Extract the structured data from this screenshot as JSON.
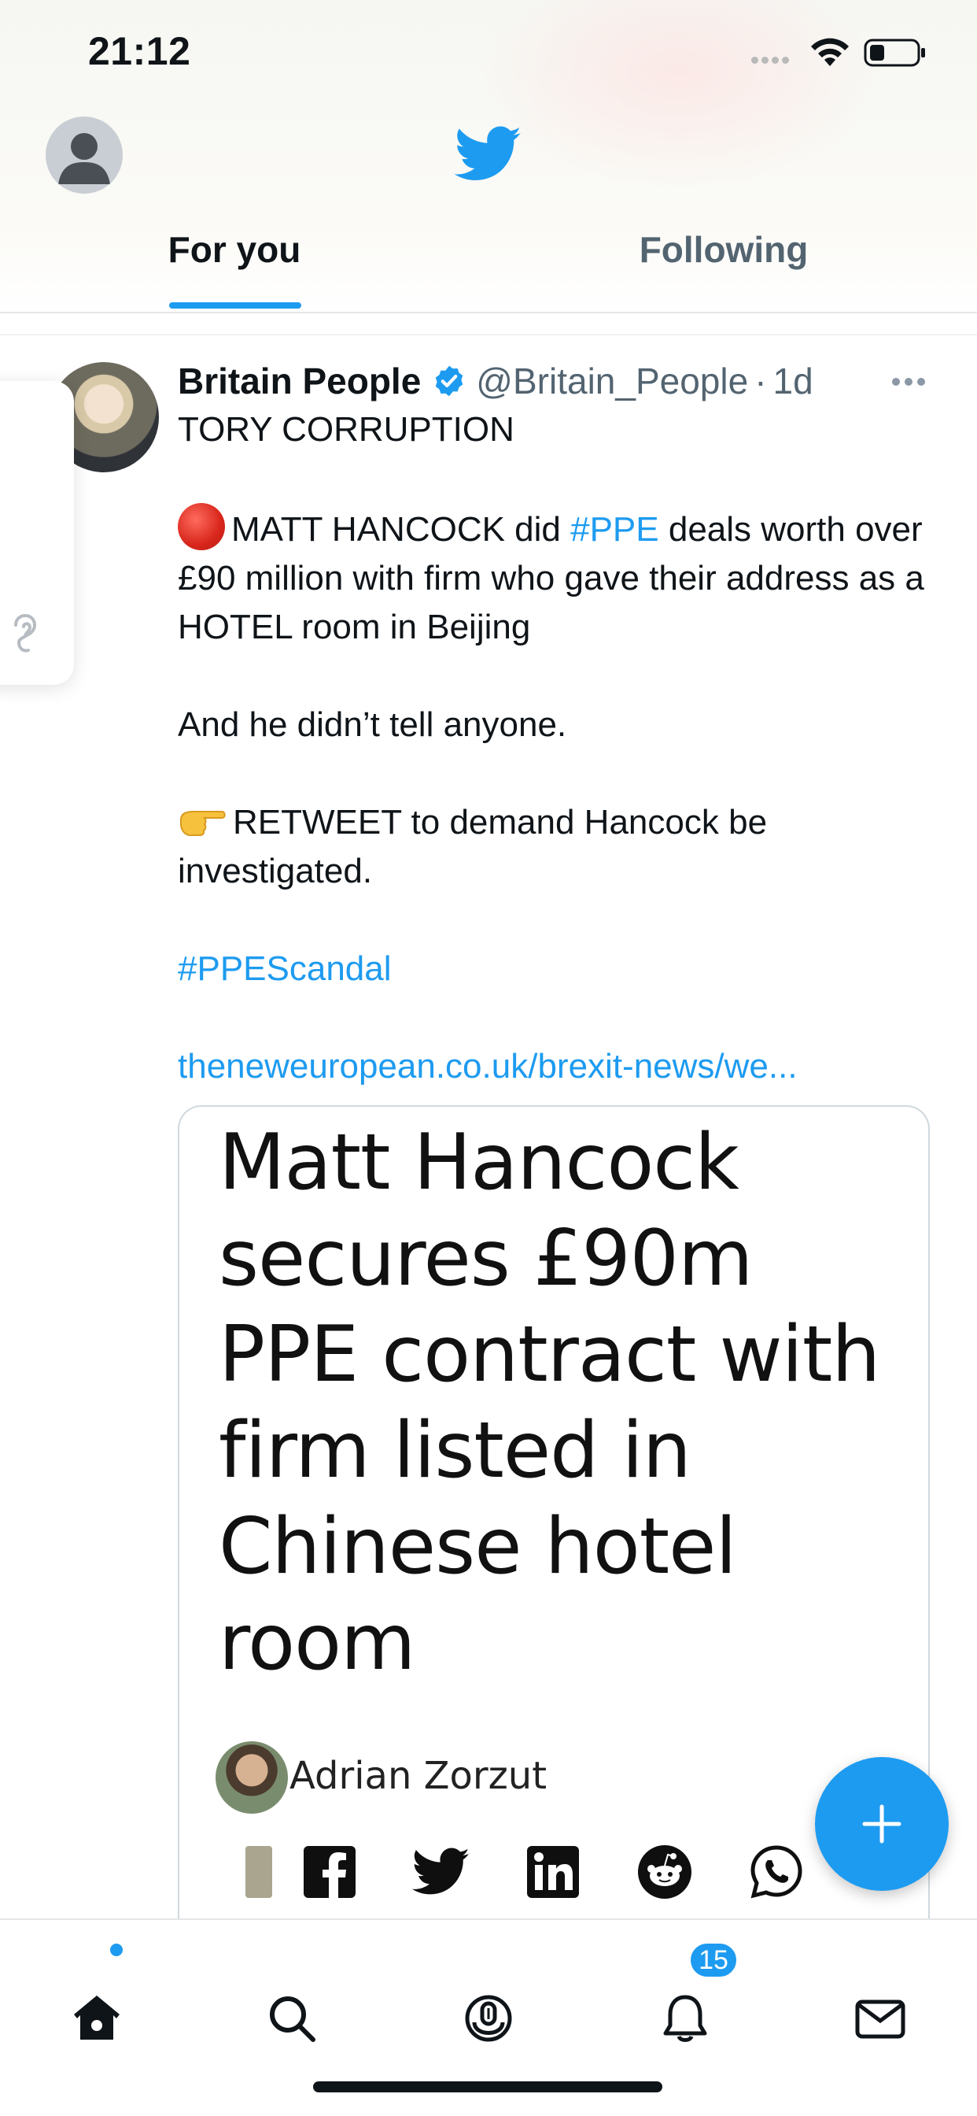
{
  "status_bar": {
    "time": "21:12"
  },
  "header": {
    "tabs": [
      {
        "label": "For you",
        "active": true
      },
      {
        "label": "Following",
        "active": false
      }
    ]
  },
  "tweet": {
    "author_name": "Britain People",
    "handle": "@Britain_People",
    "separator": "·",
    "time": "1d",
    "verified": true,
    "line1": "TORY CORRUPTION",
    "line2_pre": "MATT HANCOCK did ",
    "line2_hashtag": "#PPE",
    "line2_post": " deals worth over £90 million with firm who gave their address as a HOTEL room in Beijing",
    "line3": "And he didn’t tell anyone.",
    "line4": "RETWEET to demand Hancock be investigated.",
    "hashtag": "#PPEScandal",
    "link": "theneweuropean.co.uk/brexit-news/we..."
  },
  "card": {
    "headline": "Matt Hancock secures £90m PPE contract with firm listed in Chinese hotel room",
    "author": "Adrian Zorzut",
    "share_icons": [
      "flipboard-icon",
      "facebook-icon",
      "twitter-icon",
      "linkedin-icon",
      "reddit-icon",
      "whatsapp-icon"
    ]
  },
  "bottom_nav": {
    "items": [
      "home-icon",
      "search-icon",
      "spaces-icon",
      "notifications-icon",
      "messages-icon"
    ],
    "notification_count": "15"
  },
  "colors": {
    "accent": "#1d9bf0",
    "text": "#0f1419",
    "secondary": "#536471"
  }
}
